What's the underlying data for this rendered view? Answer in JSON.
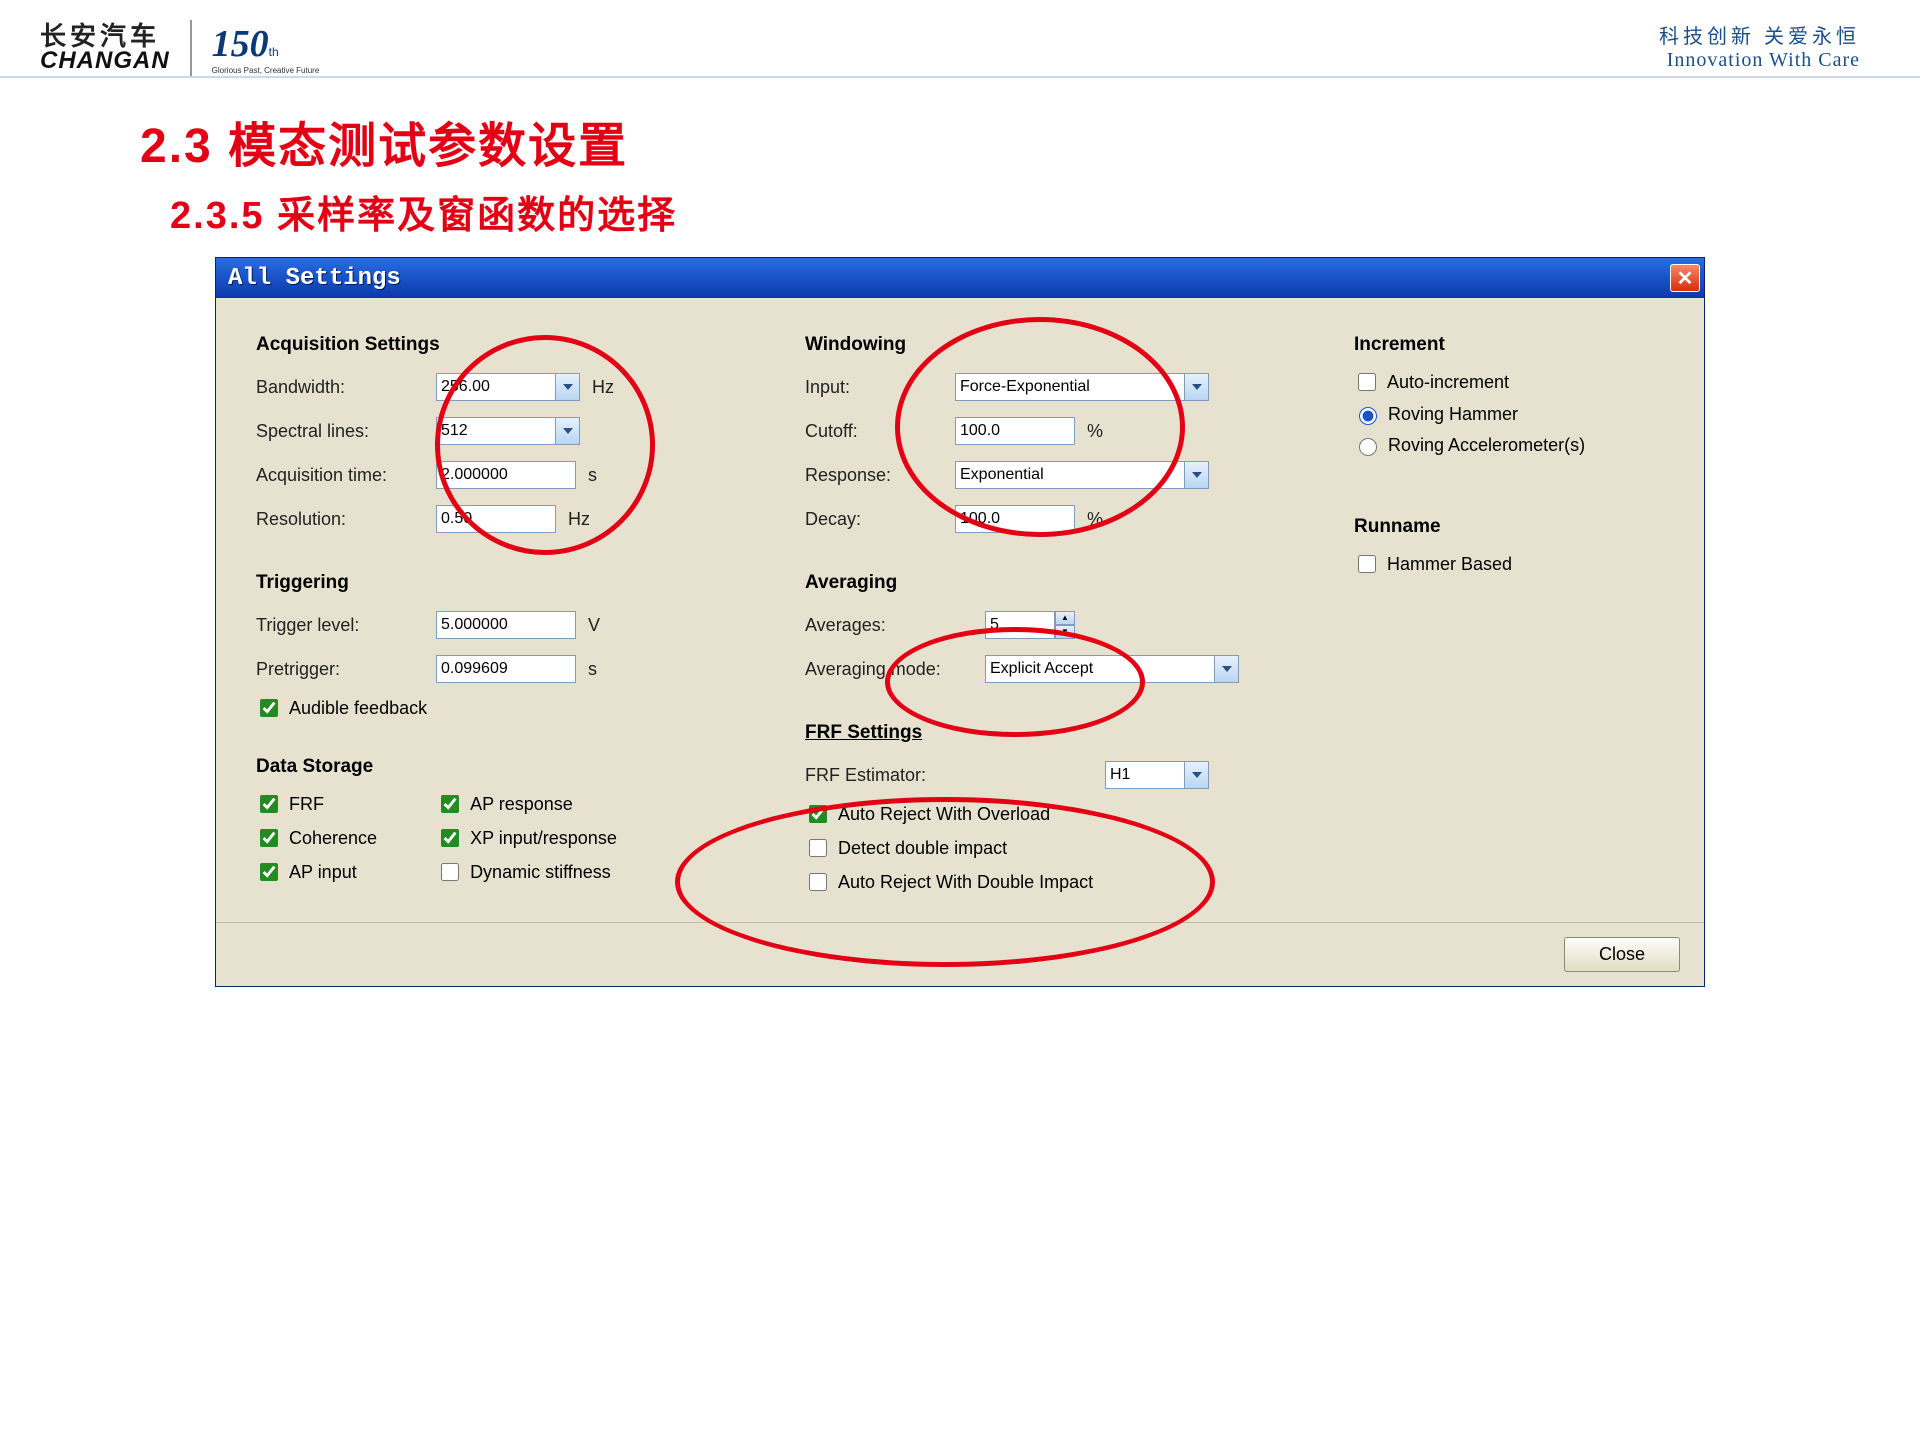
{
  "header": {
    "logo_cn": "长安汽车",
    "logo_en": "CHANGAN",
    "logo_150": "150",
    "logo_sub": "Glorious Past, Creative Future",
    "slogan_cn": "科技创新  关爱永恒",
    "slogan_en": "Innovation With Care"
  },
  "slide": {
    "title": "2.3  模态测试参数设置",
    "subtitle": "2.3.5  采样率及窗函数的选择"
  },
  "dialog": {
    "title": "All Settings",
    "close_btn": "Close"
  },
  "acq": {
    "heading": "Acquisition Settings",
    "bandwidth_lbl": "Bandwidth:",
    "bandwidth_val": "256.00",
    "bandwidth_unit": "Hz",
    "spectral_lbl": "Spectral lines:",
    "spectral_val": "512",
    "acqtime_lbl": "Acquisition time:",
    "acqtime_val": "2.000000",
    "acqtime_unit": "s",
    "resolution_lbl": "Resolution:",
    "resolution_val": "0.50",
    "resolution_unit": "Hz"
  },
  "trig": {
    "heading": "Triggering",
    "level_lbl": "Trigger level:",
    "level_val": "5.000000",
    "level_unit": "V",
    "pretrig_lbl": "Pretrigger:",
    "pretrig_val": "0.099609",
    "pretrig_unit": "s",
    "aud_lbl": "Audible feedback"
  },
  "storage": {
    "heading": "Data Storage",
    "frf": "FRF",
    "coh": "Coherence",
    "apin": "AP input",
    "apresp": "AP response",
    "xp": "XP input/response",
    "dynstiff": "Dynamic stiffness"
  },
  "window": {
    "heading": "Windowing",
    "input_lbl": "Input:",
    "input_val": "Force-Exponential",
    "cutoff_lbl": "Cutoff:",
    "cutoff_val": "100.0",
    "cutoff_unit": "%",
    "resp_lbl": "Response:",
    "resp_val": "Exponential",
    "decay_lbl": "Decay:",
    "decay_val": "100.0",
    "decay_unit": "%"
  },
  "avg": {
    "heading": "Averaging",
    "avg_lbl": "Averages:",
    "avg_val": "5",
    "mode_lbl": "Averaging mode:",
    "mode_val": "Explicit Accept"
  },
  "frf": {
    "heading": "FRF Settings",
    "est_lbl": "FRF Estimator:",
    "est_val": "H1",
    "arej": "Auto Reject With Overload",
    "ddi": "Detect double impact",
    "ardi": "Auto Reject With Double Impact"
  },
  "inc": {
    "heading": "Increment",
    "auto": "Auto-increment",
    "rh": "Roving Hammer",
    "ra": "Roving Accelerometer(s)"
  },
  "run": {
    "heading": "Runname",
    "hb": "Hammer Based"
  }
}
